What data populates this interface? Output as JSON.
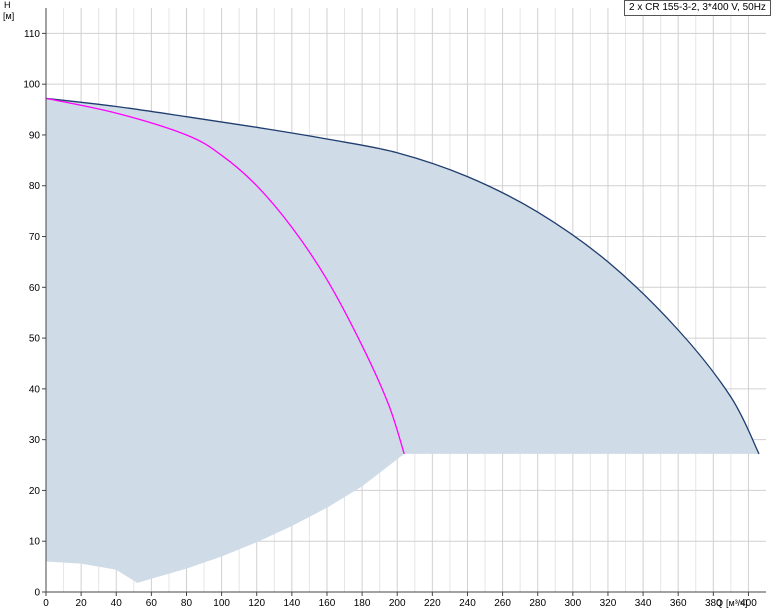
{
  "chart_data": {
    "type": "line",
    "legend": "2 x CR 155-3-2, 3*400 V, 50Hz",
    "legend_placement": "top-right",
    "grid": true,
    "xlabel": "Q",
    "xunit": "[м³/ч]",
    "ylabel": "H",
    "yunit": "[м]",
    "xlim": [
      0,
      410
    ],
    "ylim": [
      0,
      115
    ],
    "x_ticks": [
      0,
      20,
      40,
      60,
      80,
      100,
      120,
      140,
      160,
      180,
      200,
      220,
      240,
      260,
      280,
      300,
      320,
      340,
      360,
      380,
      400
    ],
    "y_ticks": [
      0,
      10,
      20,
      30,
      40,
      50,
      60,
      70,
      80,
      90,
      100,
      110
    ],
    "colors": {
      "region": "#cfdbe6",
      "max_curve": "#1f3d6e",
      "operating_curve": "#ff00ff",
      "grid": "#d0d0d0"
    },
    "region_lower_boundary": [
      [
        0,
        6
      ],
      [
        20,
        5.6
      ],
      [
        40,
        4.4
      ],
      [
        52,
        1.8
      ],
      [
        60,
        2.6
      ],
      [
        80,
        4.6
      ],
      [
        100,
        7
      ],
      [
        120,
        9.8
      ],
      [
        140,
        13
      ],
      [
        160,
        16.6
      ],
      [
        180,
        20.8
      ],
      [
        204,
        27.2
      ],
      [
        406,
        27.2
      ]
    ],
    "series": [
      {
        "name": "max_speed",
        "points": [
          [
            0,
            97.2
          ],
          [
            40,
            95.6
          ],
          [
            80,
            93.6
          ],
          [
            120,
            91.5
          ],
          [
            160,
            89.2
          ],
          [
            200,
            86.5
          ],
          [
            240,
            81.8
          ],
          [
            280,
            74.8
          ],
          [
            320,
            65.0
          ],
          [
            360,
            51.6
          ],
          [
            390,
            38.4
          ],
          [
            406,
            27.2
          ]
        ]
      },
      {
        "name": "operating",
        "points": [
          [
            0,
            97.2
          ],
          [
            40,
            94.3
          ],
          [
            80,
            90.0
          ],
          [
            100,
            86.0
          ],
          [
            120,
            80.0
          ],
          [
            140,
            71.8
          ],
          [
            160,
            61.5
          ],
          [
            180,
            48.5
          ],
          [
            195,
            37.0
          ],
          [
            204,
            27.2
          ]
        ]
      }
    ]
  }
}
